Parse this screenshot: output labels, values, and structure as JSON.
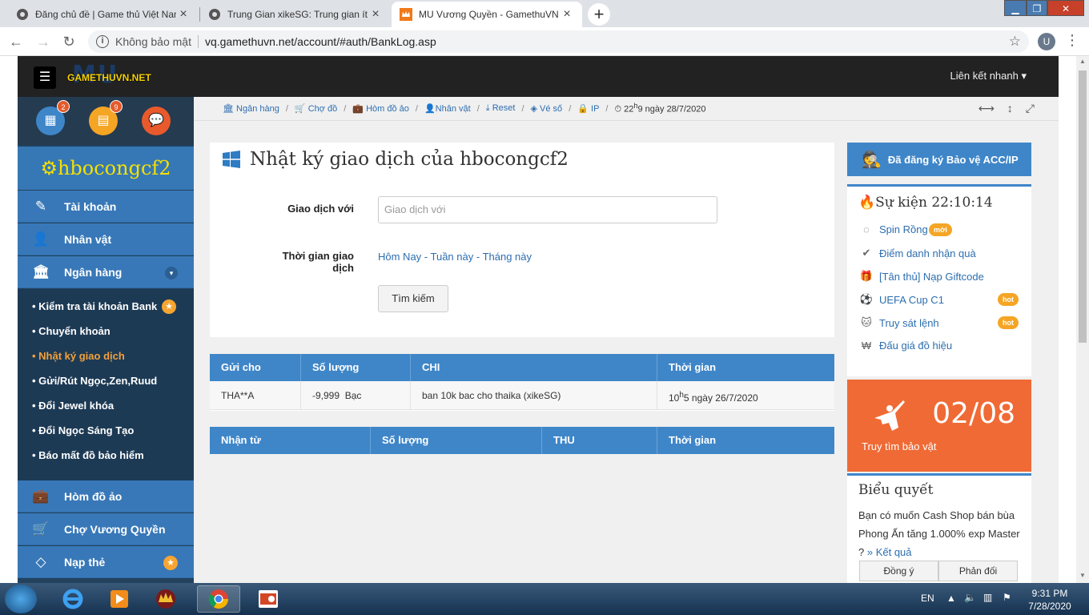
{
  "browser": {
    "tabs": [
      {
        "title": "Đăng chủ đề | Game thủ Việt Nam",
        "active": false
      },
      {
        "title": "Trung Gian xikeSG: Trung gian ít",
        "active": false
      },
      {
        "title": "MU Vương Quyền - GamethuVN",
        "active": true
      }
    ],
    "security_label": "Không bảo mật",
    "url": "vq.gamethuvn.net/account/#auth/BankLog.asp",
    "profile_initial": "U"
  },
  "site": {
    "logo_small": "GAMETHUVN.NET",
    "logo_big": "MU",
    "quick_links": "Liên kết nhanh",
    "badges": {
      "calendar": "2",
      "card": "9"
    }
  },
  "sidebar": {
    "username": "hbocongcf2",
    "items": [
      {
        "label": "Tài khoản",
        "icon": "edit-icon"
      },
      {
        "label": "Nhân vật",
        "icon": "user-icon"
      },
      {
        "label": "Ngân hàng",
        "icon": "bank-icon"
      }
    ],
    "submenu": [
      {
        "label": "• Kiểm tra tài khoản Bank",
        "star": true
      },
      {
        "label": "• Chuyển khoản"
      },
      {
        "label": "• Nhật ký giao dịch",
        "current": true
      },
      {
        "label": "• Gửi/Rút Ngọc,Zen,Ruud"
      },
      {
        "label": "• Đổi Jewel khóa"
      },
      {
        "label": "• Đổi Ngọc Sáng Tạo"
      },
      {
        "label": "• Báo mất đồ bảo hiểm"
      }
    ],
    "items2": [
      {
        "label": "Hòm đồ ảo",
        "icon": "briefcase-icon"
      },
      {
        "label": "Chợ Vương Quyền",
        "icon": "cart-icon"
      },
      {
        "label": "Nạp thẻ",
        "icon": "diamond-icon"
      }
    ]
  },
  "breadcrumbs": {
    "items": [
      "Ngân hàng",
      "Chợ đồ",
      "Hòm đồ ảo",
      "Nhân vật",
      "Reset",
      "Vé số",
      "IP"
    ],
    "time_h": "22",
    "time_sup": "h",
    "time_m": "9 ngày 28/7/2020"
  },
  "form": {
    "title": "Nhật ký giao dịch của hbocongcf2",
    "with_label": "Giao dịch với",
    "with_placeholder": "Giao dịch với",
    "time_label": "Thời gian giao dịch",
    "range_today": "Hôm Nay",
    "range_week": "Tuần này",
    "range_month": "Tháng này",
    "range_sep": " - ",
    "search_button": "Tìm kiếm"
  },
  "sent_table": {
    "headers": [
      "Gửi cho",
      "Số lượng",
      "CHI",
      "Thời gian"
    ],
    "rows": [
      {
        "to": "THA**A",
        "amount": "-9,999  Bạc",
        "note": "ban 10k bac cho thaika (xikeSG)",
        "time_h": "10",
        "time_sup": "h",
        "time_rest": "5 ngày 26/7/2020"
      }
    ]
  },
  "received_table": {
    "headers": [
      "Nhận từ",
      "Số lượng",
      "THU",
      "Thời gian"
    ]
  },
  "right": {
    "protect": "Đã đăng ký Bảo vệ ACC/IP",
    "events_title": "Sự kiện 22:10:14",
    "events": [
      {
        "label": "Spin Rồng",
        "tag": "mới",
        "icon": "spinner-icon"
      },
      {
        "label": "Điểm danh nhận quà",
        "icon": "check-circle-icon"
      },
      {
        "label": "[Tân thủ] Nạp Giftcode",
        "icon": "gift-icon"
      },
      {
        "label": "UEFA Cup C1",
        "tag": "hot",
        "icon": "soccer-ball-icon"
      },
      {
        "label": "Truy sát lệnh",
        "tag": "hot",
        "icon": "github-icon"
      },
      {
        "label": "Đấu giá đồ hiệu",
        "icon": "won-icon"
      }
    ],
    "treasure_count": "02/08",
    "treasure_label": "Truy tìm bảo vật",
    "poll_title": "Biểu quyết",
    "poll_question": "Bạn có muốn Cash Shop bán bùa Phong Ấn tăng 1.000% exp Master ?",
    "poll_result": "» Kết quả",
    "poll_yes": "Đồng ý",
    "poll_no": "Phản đối"
  },
  "taskbar": {
    "lang": "EN",
    "time": "9:31 PM",
    "date": "7/28/2020"
  }
}
